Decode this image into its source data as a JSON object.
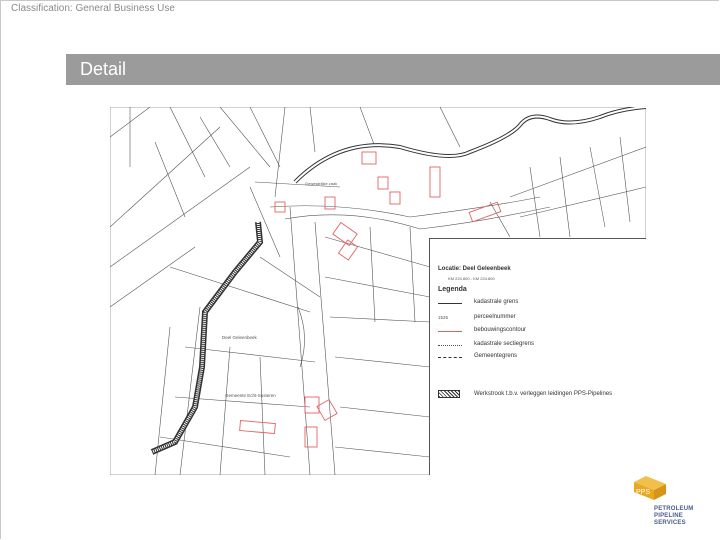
{
  "classification": "Classification: General Business Use",
  "title": "Detail",
  "map": {
    "labels": {
      "municipality_1": "Deel Geleenbeek",
      "municipality_2": "Gemeente Echt-Susteren",
      "road_label": "Gewestelijke zaak"
    },
    "colors": {
      "line": "#444444",
      "building": "#e06464",
      "strip": "#333333"
    }
  },
  "legend": {
    "location": "Locatie:  Deel Geleenbeek",
    "coords": "KM 224.800 - KM 224.800",
    "title": "Legenda",
    "items": [
      {
        "label": "kadastrale grens",
        "symbol": "solid"
      },
      {
        "label": "perceelnummer",
        "symbol": "number",
        "sample": "1526"
      },
      {
        "label": "bebouwingscontour",
        "symbol": "red"
      },
      {
        "label": "kadastrale sectiegrens",
        "symbol": "dotted"
      },
      {
        "label": "Gemeentegrens",
        "symbol": "dashed"
      },
      {
        "label": "Werkstrook t.b.v. verleggen leidingen PPS-Pipelines",
        "symbol": "hatch"
      }
    ]
  },
  "logo": {
    "mark": "PPS",
    "line1": "PETROLEUM",
    "line2": "PIPELINE",
    "line3": "SERVICES"
  }
}
